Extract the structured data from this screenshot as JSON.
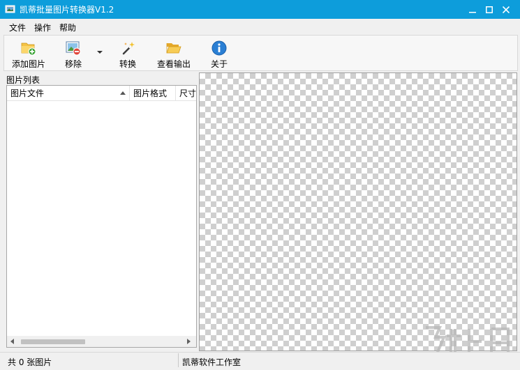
{
  "window": {
    "title": "凯蒂批量图片转换器V1.2",
    "accent_color": "#0d9ddb",
    "controls": [
      "minimize-icon",
      "maximize-icon",
      "close-icon"
    ]
  },
  "menu": {
    "items": [
      {
        "label": "文件"
      },
      {
        "label": "操作"
      },
      {
        "label": "帮助"
      }
    ]
  },
  "toolbar": {
    "buttons": [
      {
        "label": "添加图片",
        "icon": "add-folder-icon"
      },
      {
        "label": "移除",
        "icon": "remove-image-icon"
      },
      {
        "label": "转换",
        "icon": "magic-wand-icon"
      },
      {
        "label": "查看输出",
        "icon": "open-folder-icon"
      },
      {
        "label": "关于",
        "icon": "info-icon"
      }
    ],
    "dropdown_icon": "dropdown-arrow-icon"
  },
  "image_list": {
    "title": "图片列表",
    "columns": [
      {
        "label": "图片文件",
        "sort_icon": "sort-up-icon"
      },
      {
        "label": "图片格式"
      },
      {
        "label": "尺寸"
      }
    ],
    "rows": []
  },
  "status": {
    "count_text": "共 0 张图片",
    "company": "凯蒂软件工作室"
  }
}
